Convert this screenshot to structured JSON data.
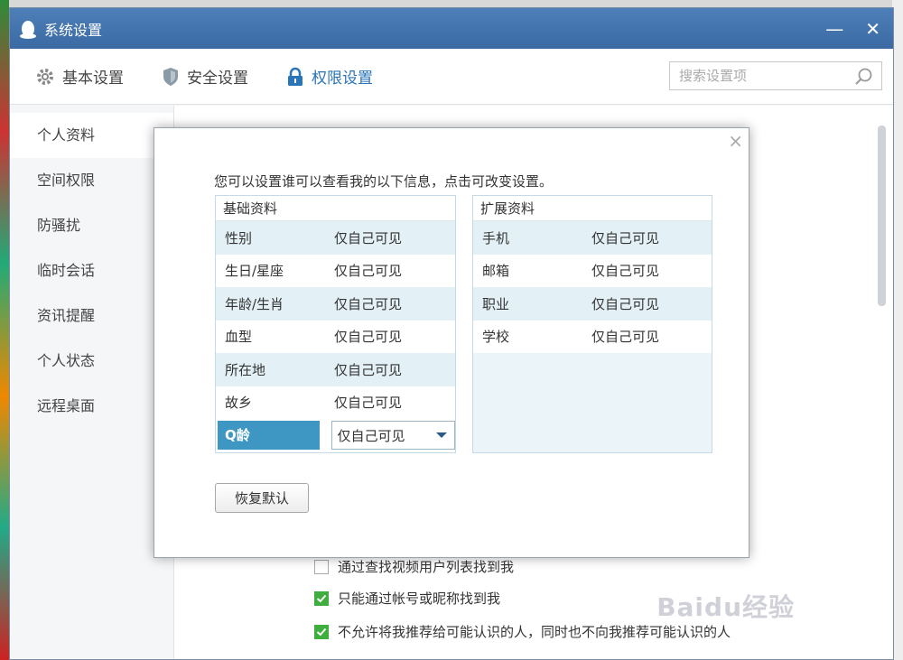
{
  "window": {
    "title": "系统设置",
    "minimize": "—",
    "close": "✕"
  },
  "toolbar": {
    "tabs": [
      {
        "label": "基本设置",
        "icon": "gear-icon"
      },
      {
        "label": "安全设置",
        "icon": "shield-icon"
      },
      {
        "label": "权限设置",
        "icon": "lock-icon"
      }
    ],
    "search_placeholder": "搜索设置项",
    "accent": "#2a74b8"
  },
  "sidebar": {
    "items": [
      {
        "label": "个人资料"
      },
      {
        "label": "空间权限"
      },
      {
        "label": "防骚扰"
      },
      {
        "label": "临时会话"
      },
      {
        "label": "资讯提醒"
      },
      {
        "label": "个人状态"
      },
      {
        "label": "远程桌面"
      }
    ]
  },
  "content": {
    "checks": [
      {
        "label": "通过查找视频用户列表找到我",
        "checked": false
      },
      {
        "label": "只能通过帐号或昵称找到我",
        "checked": true
      },
      {
        "label": "不允许将我推荐给可能认识的人，同时也不向我推荐可能认识的人",
        "checked": true
      }
    ]
  },
  "dialog": {
    "close": "×",
    "intro": "您可以设置谁可以查看我的以下信息，点击可改变设置。",
    "basic": {
      "title": "基础资料",
      "rows": [
        {
          "key": "性别",
          "value": "仅自己可见"
        },
        {
          "key": "生日/星座",
          "value": "仅自己可见"
        },
        {
          "key": "年龄/生肖",
          "value": "仅自己可见"
        },
        {
          "key": "血型",
          "value": "仅自己可见"
        },
        {
          "key": "所在地",
          "value": "仅自己可见"
        },
        {
          "key": "故乡",
          "value": "仅自己可见"
        }
      ],
      "selected": {
        "key": "Q龄",
        "value": "仅自己可见"
      }
    },
    "extended": {
      "title": "扩展资料",
      "rows": [
        {
          "key": "手机",
          "value": "仅自己可见"
        },
        {
          "key": "邮箱",
          "value": "仅自己可见"
        },
        {
          "key": "职业",
          "value": "仅自己可见"
        },
        {
          "key": "学校",
          "value": "仅自己可见"
        }
      ]
    },
    "reset_label": "恢复默认"
  },
  "watermark": "Baidu经验"
}
